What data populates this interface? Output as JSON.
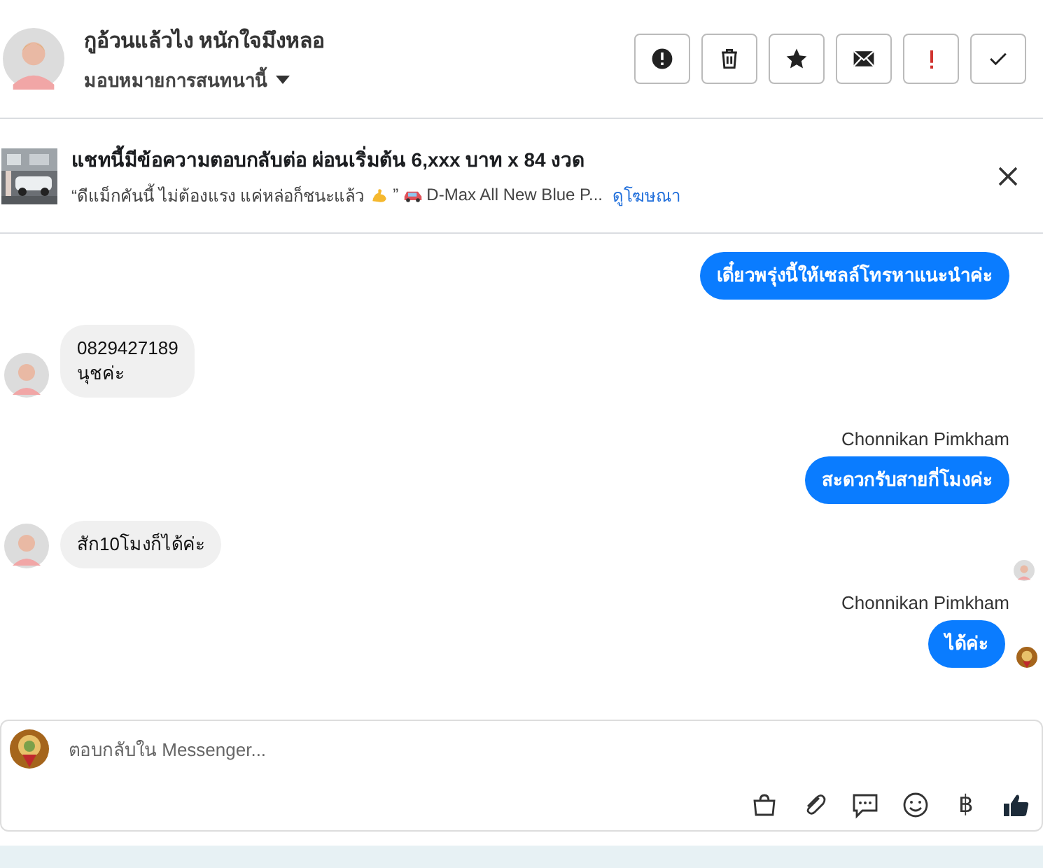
{
  "header": {
    "name": "กูอ้วนแล้วไง หนักใจมึงหลอ",
    "assign": "มอบหมายการสนทนานี้",
    "actions": [
      {
        "kind": "alert"
      },
      {
        "kind": "trash"
      },
      {
        "kind": "star"
      },
      {
        "kind": "mail"
      },
      {
        "kind": "important"
      },
      {
        "kind": "done"
      }
    ]
  },
  "ad": {
    "title": "แชทนี้มีข้อความตอบกลับต่อ ผ่อนเริ่มต้น 6,xxx บาท x 84 งวด",
    "quote": "“ดีแม็กคันนี้ ไม่ต้องแรง แค่หล่อก็ชนะแล้ว",
    "quote_end": "”",
    "product": "D-Max All New Blue P...",
    "link": "ดูโฆษณา"
  },
  "messages": [
    {
      "kind": "outgoing",
      "lines": [
        "เดี๋ยวพรุ่งนี้ให้เซลล์โทรหาแนะนำค่ะ"
      ]
    },
    {
      "kind": "incoming",
      "lines": [
        "0829427189",
        "นุชค่ะ"
      ]
    },
    {
      "kind": "outgoing",
      "sender": "Chonnikan Pimkham",
      "lines": [
        "สะดวกรับสายกี่โมงค่ะ"
      ]
    },
    {
      "kind": "incoming",
      "lines": [
        "สัก10โมงก็ได้ค่ะ"
      ],
      "seen": true
    },
    {
      "kind": "outgoing",
      "sender": "Chonnikan Pimkham",
      "lines": [
        "ได้ค่ะ"
      ],
      "delivered": true
    }
  ],
  "composer": {
    "placeholder": "ตอบกลับใน Messenger...",
    "currency": "฿"
  }
}
